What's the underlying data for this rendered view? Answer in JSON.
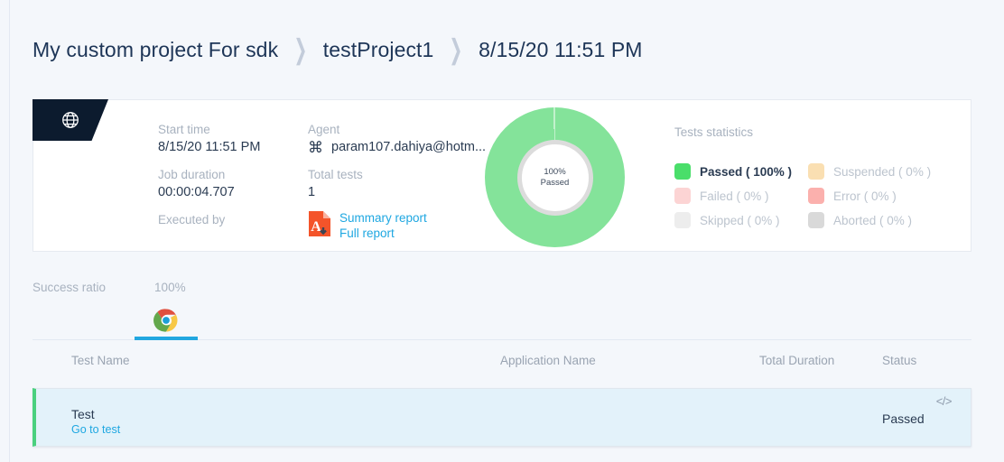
{
  "breadcrumb": {
    "items": [
      {
        "label": "My custom project For sdk"
      },
      {
        "label": "testProject1"
      },
      {
        "label": "8/15/20 11:51 PM"
      }
    ],
    "separator": "❯"
  },
  "summary": {
    "badge_icon": "globe-icon",
    "fields": [
      {
        "label": "Start time",
        "value": "8/15/20 11:51 PM"
      },
      {
        "label": "Agent",
        "value": "param107.dahiya@hotm...",
        "icon": "command-icon"
      },
      {
        "label": "Job duration",
        "value": "00:00:04.707"
      },
      {
        "label": "Total tests",
        "value": "1"
      },
      {
        "label": "Executed by",
        "value": ""
      }
    ],
    "reports": {
      "icon": "pdf-download-icon",
      "summary_label": "Summary report",
      "full_label": "Full report"
    }
  },
  "donut": {
    "percent_text": "100%",
    "status_text": "Passed",
    "passed_fraction": 1.0,
    "ring_color": "#84e39a",
    "hole_ring_color": "#dcdcdc"
  },
  "statistics": {
    "title": "Tests statistics",
    "items": [
      {
        "label": "Passed ( 100% )",
        "color": "#4ade6a",
        "active": true
      },
      {
        "label": "Suspended ( 0% )",
        "color": "#fadfb2",
        "active": false
      },
      {
        "label": "Failed ( 0% )",
        "color": "#fcd4d4",
        "active": false
      },
      {
        "label": "Error ( 0% )",
        "color": "#fbb0ad",
        "active": false
      },
      {
        "label": "Skipped ( 0% )",
        "color": "#ededed",
        "active": false
      },
      {
        "label": "Aborted ( 0% )",
        "color": "#d9d9d9",
        "active": false
      }
    ]
  },
  "success_ratio": {
    "label": "Success ratio",
    "value": "100%"
  },
  "browser_tab": {
    "name": "chrome-browser-tab",
    "active_color": "#22a7e0"
  },
  "table": {
    "columns": [
      "Test Name",
      "Application Name",
      "Total Duration",
      "Status"
    ],
    "rows": [
      {
        "test_name": "Test",
        "link_label": "Go to test",
        "application_name": "",
        "total_duration": "",
        "status": "Passed",
        "status_color": "#4ad07e",
        "code_icon_label": "</>"
      }
    ]
  }
}
